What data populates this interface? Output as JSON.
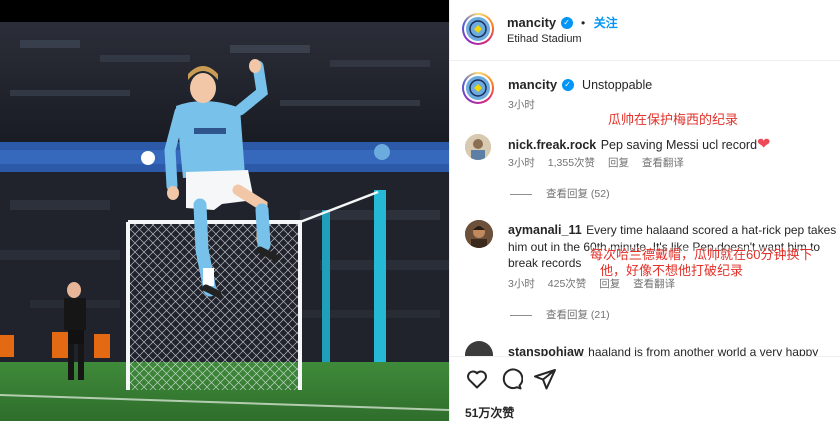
{
  "header": {
    "username": "mancity",
    "follow_label": "关注",
    "dot": "•",
    "location": "Etihad Stadium"
  },
  "caption": {
    "username": "mancity",
    "text": "Unstoppable",
    "time": "3小时"
  },
  "annotations": {
    "note1": "瓜帅在保护梅西的纪录",
    "note2_line1": "每次哈兰德戴帽，瓜帅就在60分钟换下",
    "note2_line2": "他，好像不想他打破纪录"
  },
  "comments": [
    {
      "username": "nick.freak.rock",
      "text": "Pep saving Messi ucl record",
      "time": "3小时",
      "likes": "1,355次赞",
      "reply": "回复",
      "translate": "查看翻译",
      "view_replies": "查看回复 (52)"
    },
    {
      "username": "aymanali_11",
      "text_line1": "Every time halaand scored a hat-rick pep takes",
      "text_line2": "him out in the 60th minute. It's like Pep doesn't want him to",
      "text_line3": "break records",
      "time": "3小时",
      "likes": "425次赞",
      "reply": "回复",
      "translate": "查看翻译",
      "view_replies": "查看回复 (21)"
    },
    {
      "username": "stanspohiaw",
      "text": "haaland is from another world a very happy"
    }
  ],
  "footer": {
    "likes": "51万次赞"
  },
  "icons": {
    "like": "heart-icon",
    "comment": "comment-icon",
    "share": "share-icon",
    "verified": "verified-badge-icon"
  },
  "colors": {
    "accent_blue": "#0095f6",
    "annotation_red": "#e2312a",
    "city_blue": "#6cabdd"
  }
}
